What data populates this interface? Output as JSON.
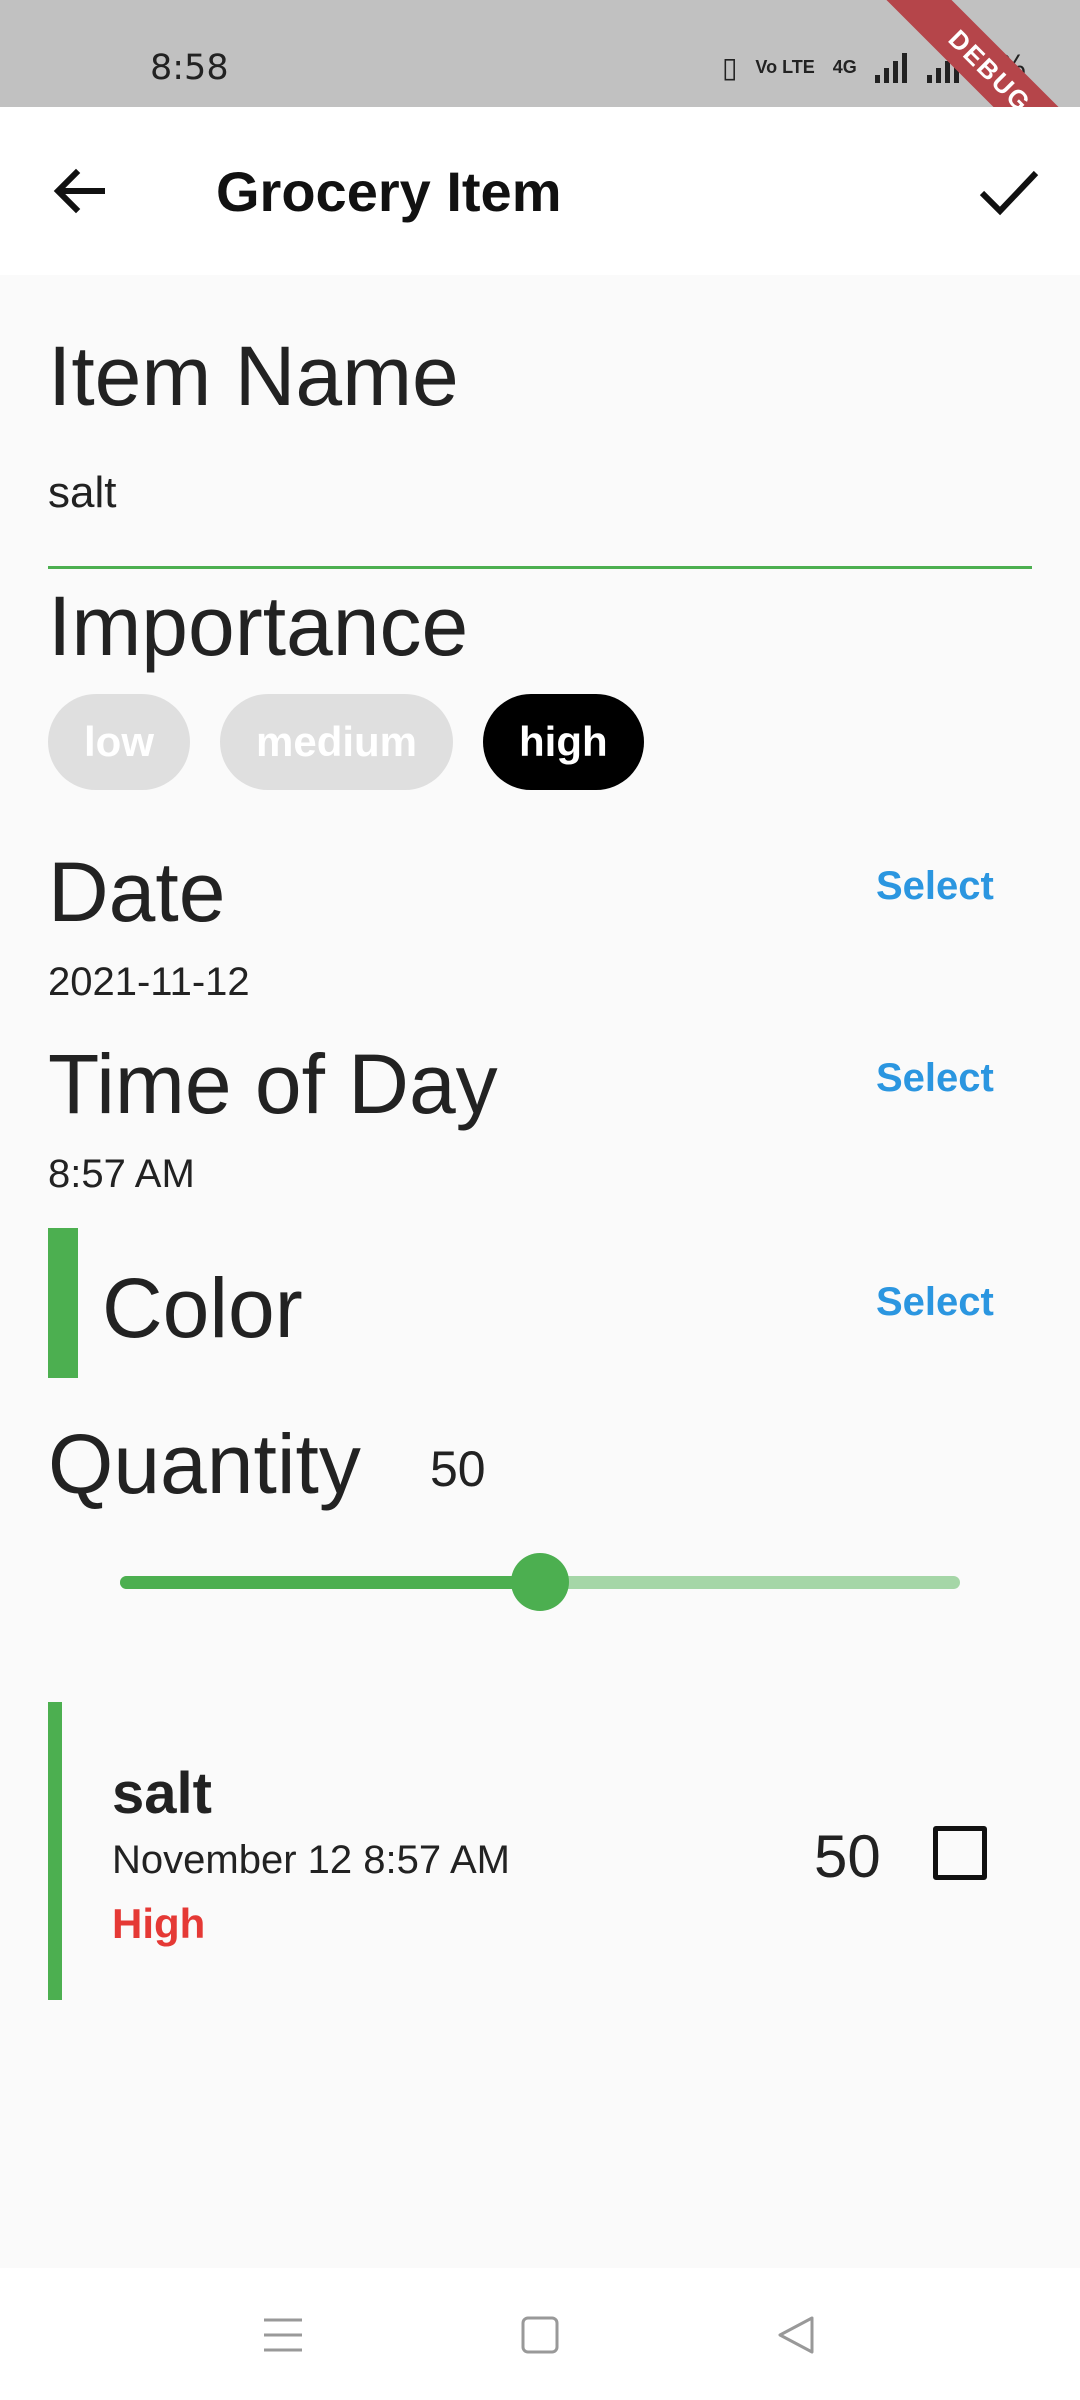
{
  "status_bar": {
    "time": "8:58",
    "battery": "7%",
    "debug_label": "DEBUG",
    "volte_label": "Vo LTE",
    "network_label": "4G"
  },
  "app_bar": {
    "title": "Grocery Item",
    "back_icon": "arrow-back-icon",
    "confirm_icon": "check-icon"
  },
  "item_name": {
    "label": "Item Name",
    "value": "salt"
  },
  "importance": {
    "label": "Importance",
    "options": [
      "low",
      "medium",
      "high"
    ],
    "selected": "high"
  },
  "date": {
    "label": "Date",
    "value": "2021-11-12",
    "select_label": "Select"
  },
  "time_of_day": {
    "label": "Time of Day",
    "value": "8:57 AM",
    "select_label": "Select"
  },
  "color": {
    "label": "Color",
    "value": "#4caf50",
    "select_label": "Select"
  },
  "quantity": {
    "label": "Quantity",
    "value": "50",
    "slider_fraction": 0.5
  },
  "preview": {
    "name": "salt",
    "datetime": "November 12 8:57 AM",
    "importance": "High",
    "quantity": "50",
    "checked": false
  },
  "colors": {
    "accent": "#4caf50",
    "link": "#2b96e0",
    "importance_high": "#e53935"
  }
}
